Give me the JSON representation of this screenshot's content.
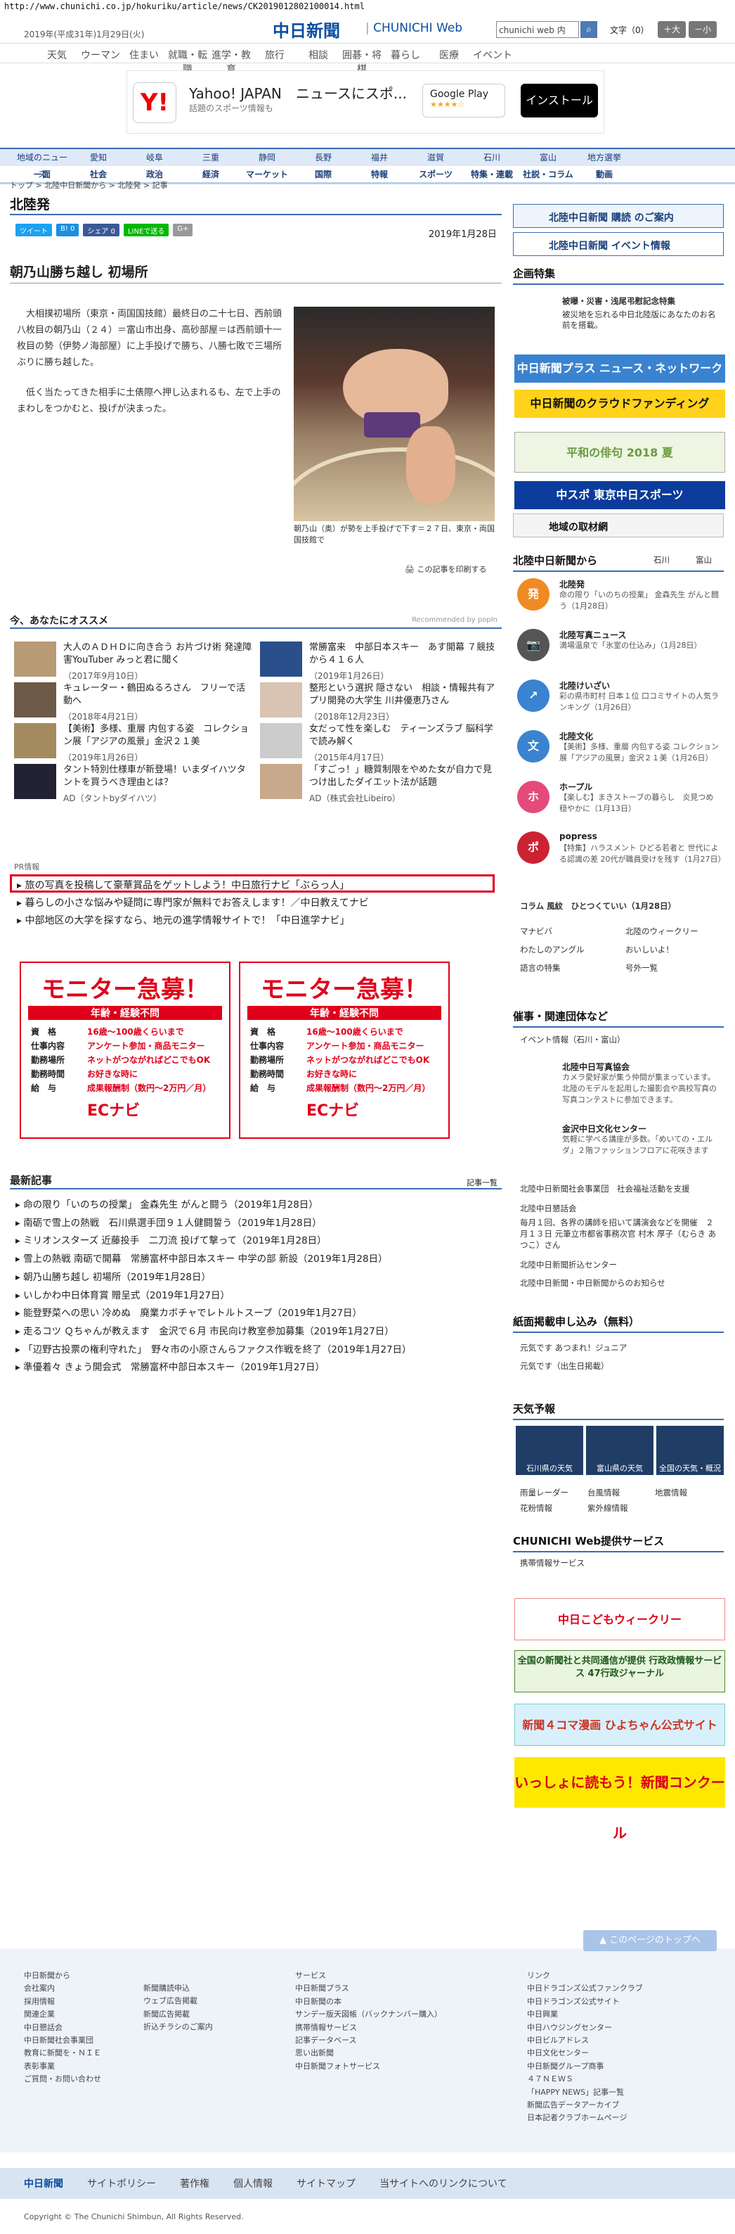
{
  "url": "http://www.chunichi.co.jp/hokuriku/article/news/CK2019012802100014.html",
  "header": {
    "date": "2019年(平成31年)1月29日(火)",
    "logo": "中日新聞",
    "logo_web": "CHUNICHI Web",
    "search_placeholder": "chunichi web 内",
    "font_label": "文字（0）",
    "font_up": "＋大",
    "font_down": "－小"
  },
  "global_nav": [
    "天気",
    "ウーマン",
    "住まい",
    "就職・転職",
    "進学・教育",
    "旅行",
    "相談",
    "囲碁・将棋",
    "暮らし",
    "医療",
    "イベント"
  ],
  "ad": {
    "title": "Yahoo! JAPAN　ニュースにスポ...",
    "sub": "話題のスポーツ情報も",
    "play": "Google Play",
    "stars": "★★★★☆",
    "install": "インストール"
  },
  "region_nav": [
    "地域のニュース",
    "愛知",
    "岐阜",
    "三重",
    "静岡",
    "長野",
    "福井",
    "滋賀",
    "石川",
    "富山",
    "地方選挙"
  ],
  "cat_nav": [
    "一面",
    "社会",
    "政治",
    "経済",
    "マーケット",
    "国際",
    "特報",
    "スポーツ",
    "特集・連載",
    "社説・コラム",
    "動画"
  ],
  "breadcrumb": "トップ > 北陸中日新聞から > 北陸発 > 記事",
  "section_title": "北陸発",
  "social": [
    "ツイート",
    "B! 0",
    "シェア 0",
    "LINEで送る",
    "G+"
  ],
  "article": {
    "date": "2019年1月28日",
    "title": "朝乃山勝ち越し 初場所",
    "p1": "大相撲初場所（東京・両国国技館）最終日の二十七日、西前頭八枚目の朝乃山（２４）＝富山市出身、高砂部屋＝は西前頭十一枚目の勢（伊勢ノ海部屋）に上手投げで勝ち、八勝七敗で三場所ぶりに勝ち越した。",
    "p2": "低く当たってきた相手に土俵際へ押し込まれるも、左で上手のまわしをつかむと、投げが決まった。",
    "caption": "朝乃山（奥）が勢を上手投げで下す＝２７日、東京・両国国技館で",
    "print": "この記事を印刷する"
  },
  "reco": {
    "title": "今、あなたにオススメ",
    "powered": "Recommended by popIn",
    "items": [
      {
        "t": "大人のＡＤＨＤに向き合う お片づけ術 発達障害YouTuber みっと君に聞く",
        "d": "（2017年9月10日）"
      },
      {
        "t": "常勝富来　中部日本スキー　あす開幕 ７競技から４１６人",
        "d": "（2019年1月26日）"
      },
      {
        "t": "キュレーター・鶴田ぬるろさん　フリーで活動へ",
        "d": "（2018年4月21日）"
      },
      {
        "t": "整形という選択 隠さない　相談・情報共有アプリ開発の大学生 川井優恵乃さん",
        "d": "（2018年12月23日）"
      },
      {
        "t": "【美術】多様、重層 内包する姿　コレクション展「アジアの風景」金沢２１美",
        "d": "（2019年1月26日）"
      },
      {
        "t": "女だって性を楽しむ　ティーンズラブ 脳科学で読み解く",
        "d": "（2015年4月17日）"
      },
      {
        "t": "タント特別仕様車が新登場！いまダイハツタントを買うべき理由とは？",
        "d": "AD（タントbyダイハツ）"
      },
      {
        "t": "「すごっ！」糖質制限をやめた女が自力で見つけ出したダイエット法が話題",
        "d": "AD（株式会社Libeiro）"
      }
    ]
  },
  "pr": {
    "label": "PR情報",
    "items": [
      "旅の写真を投稿して豪華賞品をゲットしよう！中日旅行ナビ「ぶらっ人」",
      "暮らしの小さな悩みや疑問に専門家が無料でお答えします！／中日教えてナビ",
      "中部地区の大学を探すなら、地元の進学情報サイトで！「中日進学ナビ」"
    ]
  },
  "monitor": {
    "title": "モニター急募！",
    "band": "年齢・経験不問",
    "rows": [
      [
        "資　格",
        "16歳～100歳くらいまで"
      ],
      [
        "仕事内容",
        "アンケート参加・商品モニター"
      ],
      [
        "勤務場所",
        "ネットがつながればどこでもOK"
      ],
      [
        "勤務時間",
        "お好きな時に"
      ],
      [
        "給　与",
        "成果報酬制（数円～2万円／月）"
      ]
    ],
    "logo": "ECナビ"
  },
  "latest": {
    "title": "最新記事",
    "more": "記事一覧",
    "items": [
      "命の限り「いのちの授業」 金森先生 がんと闘う（2019年1月28日）",
      "南砺で雪上の熱戦　石川県選手団９１人健闘誓う（2019年1月28日）",
      "ミリオンスターズ 近藤投手　二刀流 投げて撃って（2019年1月28日）",
      "雪上の熱戦 南砺で開幕　常勝富杯中部日本スキー 中学の部 新設（2019年1月28日）",
      "朝乃山勝ち越し 初場所（2019年1月28日）",
      "いしかわ中日体育賞 贈呈式（2019年1月27日）",
      "能登野菜への思い 冷めぬ　廃業カボチャでレトルトスープ（2019年1月27日）",
      "走るコツ Ｑちゃんが教えます　金沢で６月 市民向け教室参加募集（2019年1月27日）",
      "「辺野古投票の権利守れた」　野々市の小原さんらファクス作戦を終了（2019年1月27日）",
      "準優着々 きょう開会式　常勝富杯中部日本スキー（2019年1月27日）"
    ]
  },
  "side": {
    "subscribe": "北陸中日新聞 購読 のご案内",
    "events": "北陸中日新聞 イベント情報",
    "kikaku": "企画特集",
    "kikaku_text": "被曝・災害・浅尾弔慰記念特集",
    "kikaku_text2": "被災地を忘れる中日北陸版にあなたのお名前を搭載。",
    "b1": "中日新聞プラス ニュース・ネットワーク",
    "b2": "中日新聞のクラウドファンディング",
    "b3": "平和の俳句 2018 夏",
    "b4": "中スポ 東京中日スポーツ",
    "local": "地域の取材網",
    "hokuriku": "北陸中日新聞から",
    "hokuriku_tabs": [
      "石川",
      "富山"
    ],
    "news": [
      {
        "tt": "北陸発",
        "tx": "命の限り「いのちの授業」 金森先生 がんと闘う（1月28日）"
      },
      {
        "tt": "北陸写真ニュース",
        "tx": "満場温泉で「氷室の仕込み」（1月28日）"
      },
      {
        "tt": "北陸けいざい",
        "tx": "彩の県市町村 日本１位 口コミサイトの人気ランキング（1月26日）"
      },
      {
        "tt": "北陸文化",
        "tx": "【美術】多様、重層 内包する姿 コレクション展「アジアの風景」金沢２１美（1月26日）"
      },
      {
        "tt": "ホープル",
        "tx": "【楽しむ】まきストーブの暮らし　炎見つめ 穏やかに（1月13日）"
      },
      {
        "tt": "popress",
        "tx": "【特集】ハラスメント ひどる若者と 世代による認識の差 20代が職員受けを残す（1月27日）"
      }
    ],
    "column": "コラム 風紋　ひとつくていい（1月28日）",
    "links1": [
      "マナビバ",
      "北陸のウィークリー",
      "わたしのアングル",
      "おいしいよ！",
      "語言の特集",
      "号外一覧"
    ],
    "event_title": "催事・関連団体など",
    "event_info": "イベント情報（石川・富山）",
    "orgs": [
      {
        "tt": "北陸中日写真協会",
        "tx": "カメラ愛好家が集う仲間が集まっています。北陸のモデルを起用した撮影会や高校写真の写真コンテストに参加できます。"
      },
      {
        "tt": "金沢中日文化センター",
        "tx": "気軽に学べる講座が多数。「めいての・エルダ」２階ファッションフロアに花咲きます"
      }
    ],
    "org_links": [
      "北陸中日新聞社会事業団　社会福祉活動を支援",
      "北陸中日懇話会",
      "毎月１回、各界の講師を招いて講演会などを開催　２月１３日 元筆立市都省事務次官 村木 厚子（むらき あつこ）さん",
      "北陸中日新聞折込センター",
      "北陸中日新聞・中日新聞からのお知らせ"
    ],
    "ads_title": "紙面掲載申し込み（無料）",
    "ads_links": [
      "元気です あつまれ！ジュニア",
      "元気です（出生日掲載）"
    ],
    "weather": "天気予報",
    "weather_boxes": [
      "石川県の天気",
      "富山県の天気",
      "全国の天気・概況"
    ],
    "weather_links": [
      "雨量レーダー",
      "台風情報",
      "地震情報",
      "花粉情報",
      "紫外線情報"
    ],
    "services_title": "CHUNICHI Web提供サービス",
    "services": "携帯情報サービス",
    "b5": "中日こどもウィークリー",
    "b6": "全国の新聞社と共同通信が提供 行政政情報サービス 47行政ジャーナル",
    "b7": "新聞４コマ漫画 ひよちゃん公式サイト",
    "b8": "いっしょに読もう！新聞コンクール"
  },
  "footer": {
    "totop": "このページのトップへ",
    "col1": [
      "中日新聞から",
      "会社案内",
      "採用情報",
      "関連企業",
      "中日懇話会",
      "中日新聞社会事業団",
      "教育に新聞を・ＮＩＥ",
      "表彰事業",
      "ご質問・お問い合わせ"
    ],
    "col2": [
      "新聞購読申込",
      "ウェブ広告掲載",
      "新聞広告掲載",
      "折込チラシのご案内"
    ],
    "col3": [
      "サービス",
      "中日新聞プラス",
      "中日新聞の本",
      "サンデー版天図帳（バックナンバー購入）",
      "携帯情報サービス",
      "記事データベース",
      "思い出新聞",
      "中日新聞フォトサービス"
    ],
    "col4": [
      "リンク",
      "中日ドラゴンズ公式ファンクラブ",
      "中日ドラゴンズ公式サイト",
      "中日興業",
      "中日ハウジングセンター",
      "中日ビルアドレス",
      "中日文化センター",
      "中日新聞グループ商事",
      "４７ＮＥＷＳ",
      "「HAPPY NEWS」記事一覧",
      "新聞広告データアーカイブ",
      "日本記者クラブホームページ"
    ],
    "bar": [
      "中日新聞",
      "サイトポリシー",
      "著作権",
      "個人情報",
      "サイトマップ",
      "当サイトへのリンクについて"
    ],
    "copyright": "Copyright © The Chunichi Shimbun, All Rights Reserved."
  },
  "colors": {
    "brand": "#0a4ea1",
    "accent": "#3a6cb3",
    "alert": "#e0001b"
  }
}
